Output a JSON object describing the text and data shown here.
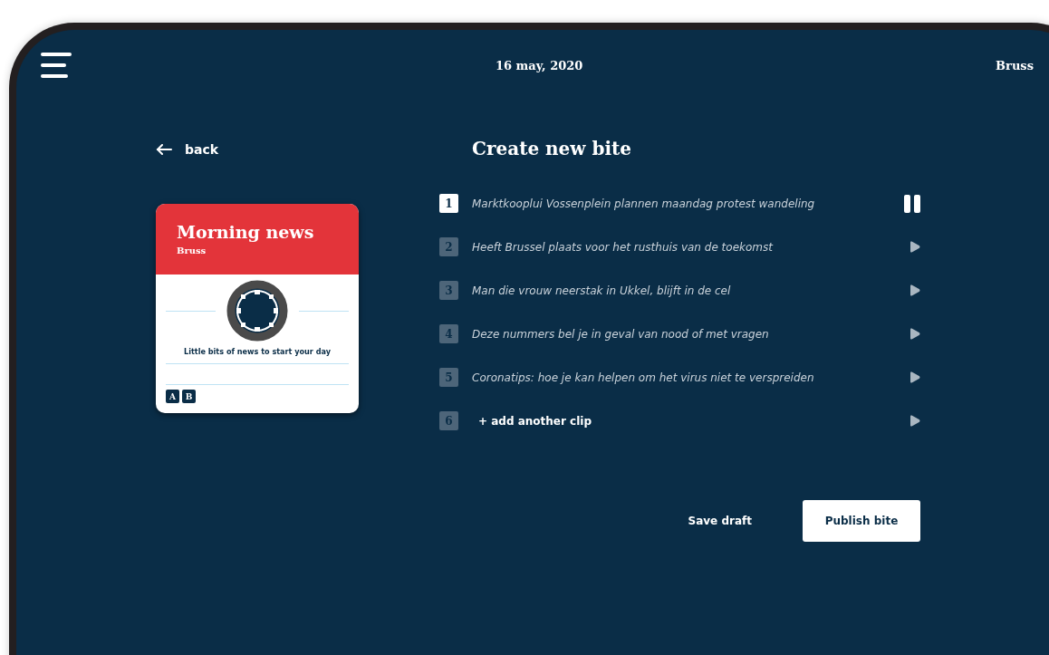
{
  "header": {
    "date": "16 may, 2020",
    "city": "Bruss"
  },
  "back": {
    "label": "back"
  },
  "card": {
    "title": "Morning news",
    "subtitle": "Bruss",
    "tagline": "Little bits of news to start your day",
    "badges": [
      "A",
      "B"
    ]
  },
  "editor": {
    "title": "Create new bite",
    "clips": [
      {
        "number": "1",
        "text": "Marktkooplui Vossenplein plannen maandag protest wandeling",
        "kind": "clip",
        "playing": true
      },
      {
        "number": "2",
        "text": "Heeft Brussel plaats voor het rusthuis van de toekomst",
        "kind": "clip",
        "playing": false
      },
      {
        "number": "3",
        "text": "Man die vrouw neerstak in Ukkel, blijft in de cel",
        "kind": "clip",
        "playing": false
      },
      {
        "number": "4",
        "text": "Deze nummers bel je in geval van nood of met vragen",
        "kind": "clip",
        "playing": false
      },
      {
        "number": "5",
        "text": "Coronatips: hoe je kan helpen om het virus niet te verspreiden",
        "kind": "clip",
        "playing": false
      },
      {
        "number": "6",
        "text": "+ add another clip",
        "kind": "add",
        "playing": false
      }
    ],
    "buttons": [
      {
        "label": "Save draft",
        "kind": "secondary"
      },
      {
        "label": "Publish bite",
        "kind": "primary"
      }
    ]
  }
}
